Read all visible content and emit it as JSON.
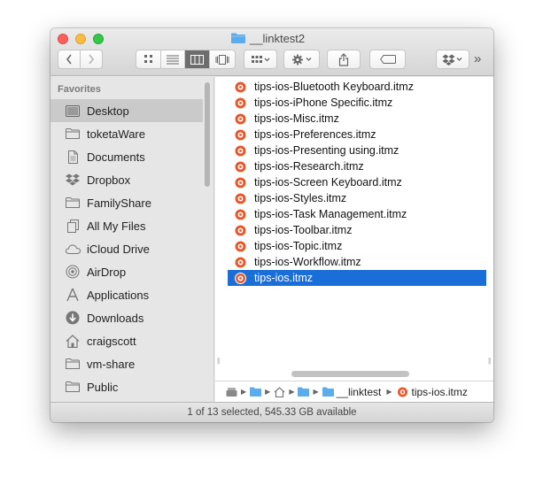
{
  "window": {
    "title": "__linktest2"
  },
  "toolbar": {
    "back_icon": "chevron-left-icon",
    "forward_icon": "chevron-right-icon",
    "view_modes": [
      "icon-view",
      "list-view",
      "column-view",
      "cover-flow-view"
    ],
    "active_view": "column-view",
    "arrange_icon": "arrange-icon",
    "action_icon": "gear-icon",
    "share_icon": "share-icon",
    "tags_icon": "tag-icon",
    "dropbox_icon": "dropbox-icon",
    "overflow": "»"
  },
  "sidebar": {
    "heading": "Favorites",
    "items": [
      {
        "label": "Desktop",
        "icon": "desktop-icon",
        "selected": true
      },
      {
        "label": "toketaWare",
        "icon": "folder-icon"
      },
      {
        "label": "Documents",
        "icon": "documents-icon"
      },
      {
        "label": "Dropbox",
        "icon": "dropbox-icon"
      },
      {
        "label": "FamilyShare",
        "icon": "folder-icon"
      },
      {
        "label": "All My Files",
        "icon": "all-files-icon"
      },
      {
        "label": "iCloud Drive",
        "icon": "cloud-icon"
      },
      {
        "label": "AirDrop",
        "icon": "airdrop-icon"
      },
      {
        "label": "Applications",
        "icon": "applications-icon"
      },
      {
        "label": "Downloads",
        "icon": "downloads-icon"
      },
      {
        "label": "craigscott",
        "icon": "home-icon"
      },
      {
        "label": "vm-share",
        "icon": "folder-icon"
      },
      {
        "label": "Public",
        "icon": "folder-icon"
      }
    ]
  },
  "files": [
    {
      "name": "tips-ios-Bluetooth Keyboard.itmz"
    },
    {
      "name": "tips-ios-iPhone Specific.itmz"
    },
    {
      "name": "tips-ios-Misc.itmz"
    },
    {
      "name": "tips-ios-Preferences.itmz"
    },
    {
      "name": "tips-ios-Presenting using.itmz"
    },
    {
      "name": "tips-ios-Research.itmz"
    },
    {
      "name": "tips-ios-Screen Keyboard.itmz"
    },
    {
      "name": "tips-ios-Styles.itmz"
    },
    {
      "name": "tips-ios-Task Management.itmz"
    },
    {
      "name": "tips-ios-Toolbar.itmz"
    },
    {
      "name": "tips-ios-Topic.itmz"
    },
    {
      "name": "tips-ios-Workflow.itmz"
    },
    {
      "name": "tips-ios.itmz",
      "selected": true
    }
  ],
  "pathbar": {
    "folder_label": "__linktest",
    "file_label": "tips-ios.itmz"
  },
  "status": {
    "text": "1 of 13 selected, 545.33 GB available"
  },
  "colors": {
    "selection": "#1a6ed8",
    "file_icon": "#e8582a",
    "folder_blue": "#5aacec"
  }
}
